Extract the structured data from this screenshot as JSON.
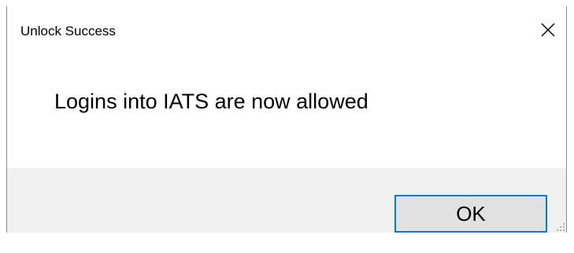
{
  "dialog": {
    "title": "Unlock Success",
    "message": "Logins into IATS are now allowed",
    "ok_label": "OK",
    "close_icon": "close-icon",
    "colors": {
      "footer_background": "#f0f0f0",
      "button_background": "#e1e1e1",
      "button_focus_border": "#0078d7"
    }
  }
}
